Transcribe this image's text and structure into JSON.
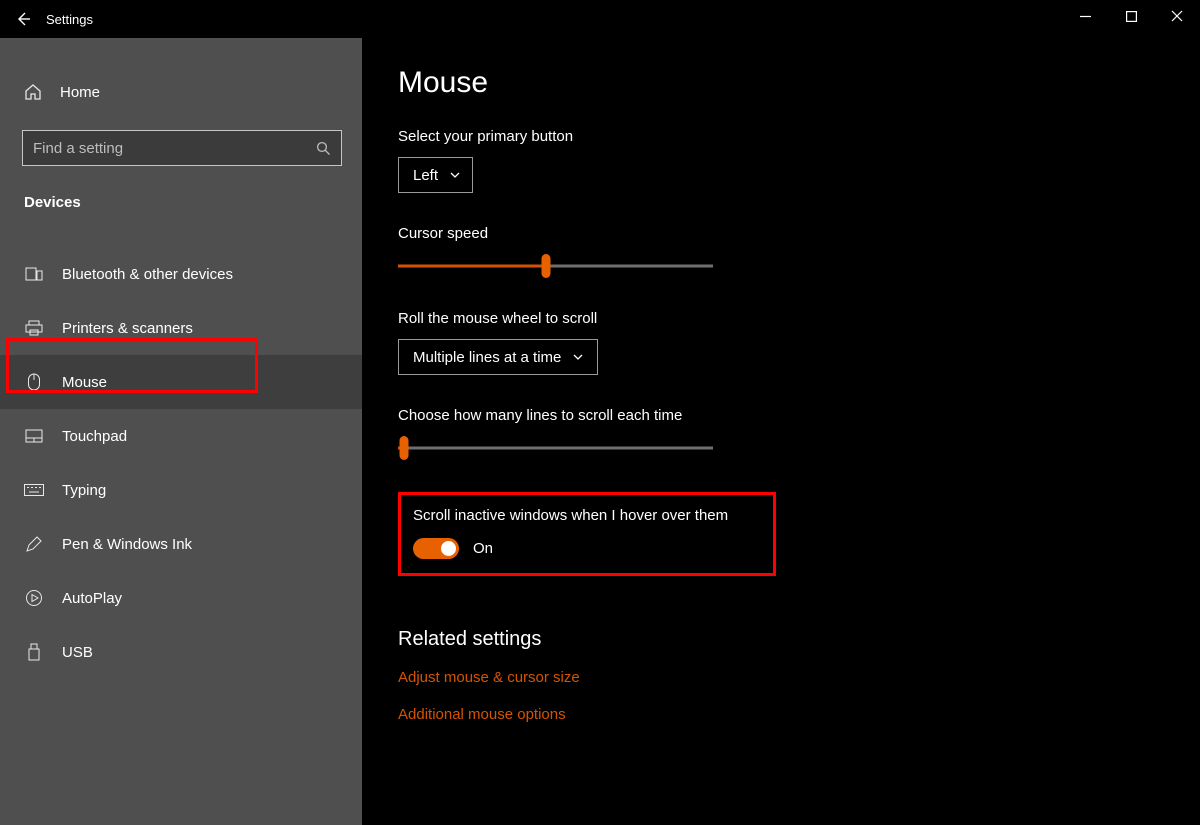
{
  "titlebar": {
    "title": "Settings"
  },
  "sidebar": {
    "home": "Home",
    "search_placeholder": "Find a setting",
    "section": "Devices",
    "items": [
      {
        "label": "Bluetooth & other devices"
      },
      {
        "label": "Printers & scanners"
      },
      {
        "label": "Mouse"
      },
      {
        "label": "Touchpad"
      },
      {
        "label": "Typing"
      },
      {
        "label": "Pen & Windows Ink"
      },
      {
        "label": "AutoPlay"
      },
      {
        "label": "USB"
      }
    ]
  },
  "main": {
    "title": "Mouse",
    "primary_button_label": "Select your primary button",
    "primary_button_value": "Left",
    "cursor_speed_label": "Cursor speed",
    "cursor_speed_percent": 47,
    "scroll_wheel_label": "Roll the mouse wheel to scroll",
    "scroll_wheel_value": "Multiple lines at a time",
    "lines_label": "Choose how many lines to scroll each time",
    "lines_percent": 2,
    "inactive_label": "Scroll inactive windows when I hover over them",
    "inactive_toggle_state": "On",
    "related_heading": "Related settings",
    "link1": "Adjust mouse & cursor size",
    "link2": "Additional mouse options"
  }
}
